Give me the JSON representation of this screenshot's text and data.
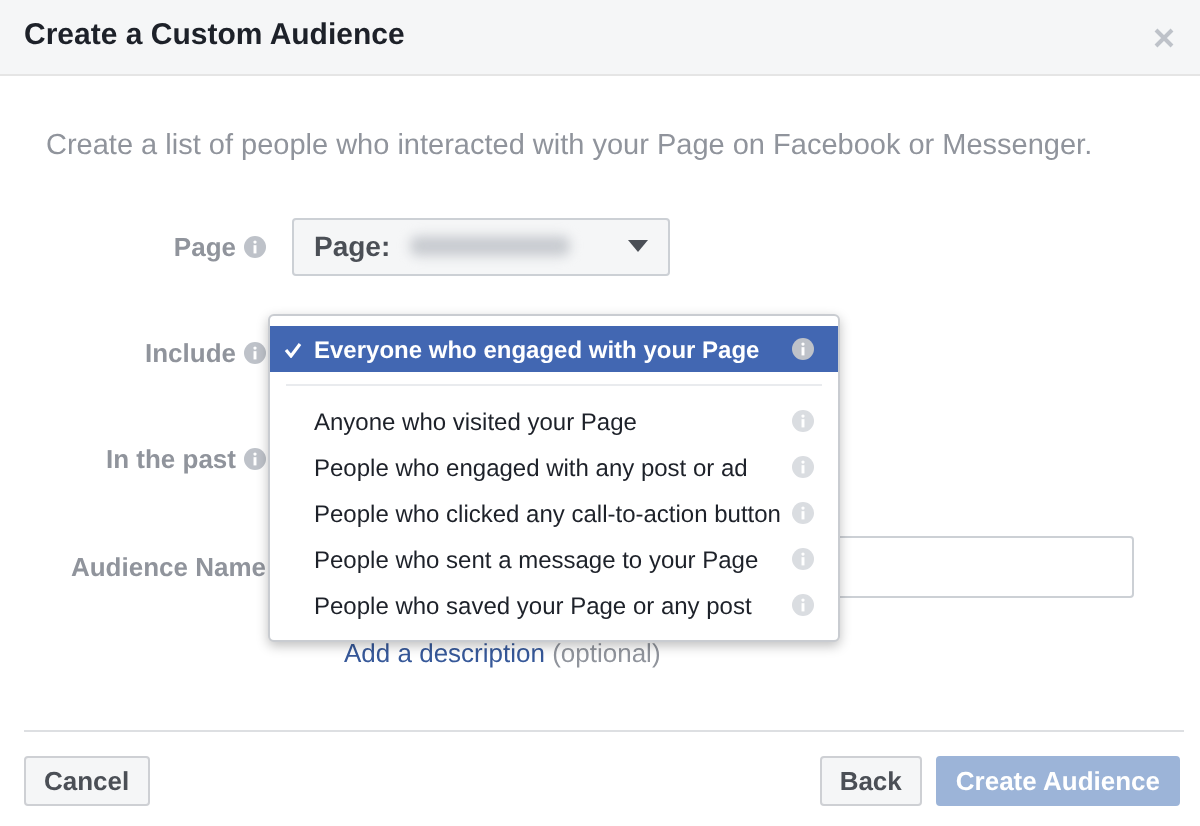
{
  "dialog": {
    "title": "Create a Custom Audience"
  },
  "description": "Create a list of people who interacted with your Page on Facebook or Messenger.",
  "fields": [
    {
      "label": "Page",
      "kind": "select",
      "value": "Page:"
    },
    {
      "label": "Include",
      "kind": "covered"
    },
    {
      "label": "In the past",
      "kind": "covered"
    },
    {
      "label": "Audience Name",
      "kind": "text"
    }
  ],
  "description_link": {
    "link": "Add a description",
    "note": "(optional)"
  },
  "dropdown": {
    "options": [
      {
        "label": "Everyone who engaged with your Page",
        "selected": true
      },
      {
        "label": "Anyone who visited your Page",
        "selected": false
      },
      {
        "label": "People who engaged with any post or ad",
        "selected": false
      },
      {
        "label": "People who clicked any call-to-action button",
        "selected": false
      },
      {
        "label": "People who sent a message to your Page",
        "selected": false
      },
      {
        "label": "People who saved your Page or any post",
        "selected": false
      }
    ]
  },
  "buttons": [
    {
      "label": "Cancel",
      "kind": "secondary",
      "disabled": false
    },
    {
      "label": "Back",
      "kind": "secondary",
      "disabled": false
    },
    {
      "label": "Create Audience",
      "kind": "primary",
      "disabled": true
    }
  ]
}
